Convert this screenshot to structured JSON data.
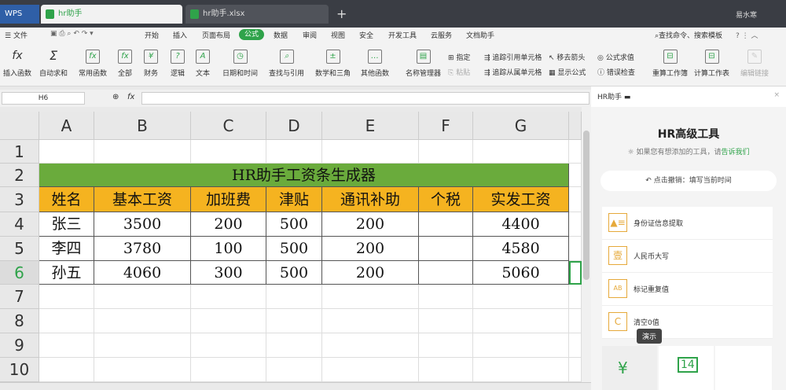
{
  "titlebar": {
    "brand": "WPS",
    "tabs": [
      {
        "label": "hr助手"
      },
      {
        "label": "hr助手.xlsx"
      }
    ],
    "user": "易水寒"
  },
  "menu": {
    "file": "文件",
    "items": [
      "开始",
      "插入",
      "页面布局",
      "公式",
      "数据",
      "审阅",
      "视图",
      "安全",
      "开发工具",
      "云服务",
      "文档助手"
    ],
    "active": "公式",
    "search": "查找命令、搜索模板"
  },
  "ribbon": {
    "big": [
      "插入函数",
      "自动求和",
      "常用函数",
      "全部",
      "财务",
      "逻辑",
      "文本",
      "日期和时间",
      "查找与引用",
      "数学和三角",
      "其他函数",
      "名称管理器"
    ],
    "small": [
      "指定",
      "粘贴",
      "追踪引用单元格",
      "追踪从属单元格",
      "移去箭头",
      "显示公式",
      "公式求值",
      "错误检查"
    ],
    "right": [
      "重算工作簿",
      "计算工作表",
      "编辑链接"
    ]
  },
  "formula_bar": {
    "cell": "H6",
    "fx": "fx",
    "value": ""
  },
  "sheet": {
    "columns": [
      "A",
      "B",
      "C",
      "D",
      "E",
      "F",
      "G"
    ],
    "rows": [
      "1",
      "2",
      "3",
      "4",
      "5",
      "6",
      "7",
      "8",
      "9",
      "10"
    ],
    "title": "HR助手工资条生成器",
    "headers": [
      "姓名",
      "基本工资",
      "加班费",
      "津贴",
      "通讯补助",
      "个税",
      "实发工资"
    ],
    "data": [
      [
        "张三",
        "3500",
        "200",
        "500",
        "200",
        "",
        "4400"
      ],
      [
        "李四",
        "3780",
        "100",
        "500",
        "200",
        "",
        "4580"
      ],
      [
        "孙五",
        "4060",
        "300",
        "500",
        "200",
        "",
        "5060"
      ]
    ],
    "colors": {
      "title_bg": "#6aab3c",
      "header_bg": "#f5b320"
    }
  },
  "panel": {
    "head": "HR助手",
    "title": "HR高级工具",
    "subtitle": "如果您有想添加的工具，请",
    "link": "告诉我们",
    "undo": "点击撤销：填写当前时间",
    "tools": [
      {
        "icon": "id",
        "label": "身份证信息提取"
      },
      {
        "icon": "壹",
        "label": "人民币大写"
      },
      {
        "icon": "AB",
        "label": "标记重复值"
      },
      {
        "icon": "C",
        "label": "清空0值"
      }
    ],
    "tooltip": "演示"
  }
}
